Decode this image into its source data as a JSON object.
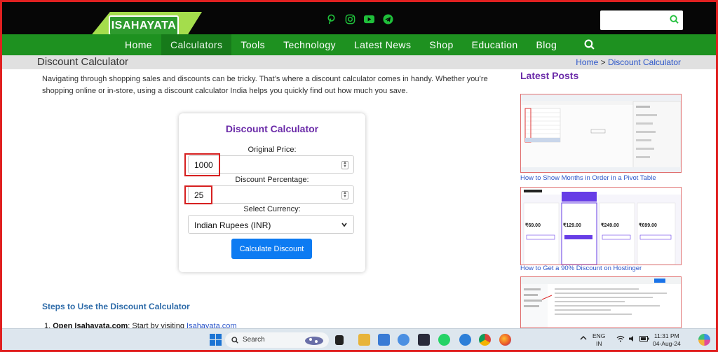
{
  "brand": {
    "logo_text": "ISAHAYATA",
    "accent": "#1e9120",
    "purple": "#6a2aa8"
  },
  "header": {
    "social_icons": [
      "pinterest-icon",
      "instagram-icon",
      "youtube-icon",
      "telegram-icon"
    ],
    "search_placeholder": ""
  },
  "nav": {
    "items": [
      {
        "label": "Home"
      },
      {
        "label": "Calculators"
      },
      {
        "label": "Tools"
      },
      {
        "label": "Technology"
      },
      {
        "label": "Latest News"
      },
      {
        "label": "Shop"
      },
      {
        "label": "Education"
      },
      {
        "label": "Blog"
      }
    ],
    "active_index": 1
  },
  "page": {
    "title": "Discount Calculator",
    "breadcrumb": {
      "home": "Home",
      "separator": ">",
      "current": "Discount Calculator"
    },
    "intro": "Navigating through shopping sales and discounts can be tricky. That’s where a discount calculator comes in handy. Whether you’re shopping online or in-store, using a discount calculator India helps you quickly find out how much you save."
  },
  "calculator": {
    "title": "Discount Calculator",
    "price_label": "Original Price:",
    "price_value": "1000",
    "discount_label": "Discount Percentage:",
    "discount_value": "25",
    "currency_label": "Select Currency:",
    "currency_value": "Indian Rupees (INR)",
    "button_label": "Calculate Discount"
  },
  "steps": {
    "heading": "Steps to Use the Discount Calculator",
    "step1_number": "1.",
    "step1_bold": "Open Isahayata.com",
    "step1_text": ": Start by visiting ",
    "step1_link": "Isahayata.com"
  },
  "sidebar": {
    "title": "Latest Posts",
    "posts": [
      {
        "title": "How to Show Months in Order in a Pivot Table"
      },
      {
        "title": "How to Get a 90% Discount on Hostinger"
      },
      {
        "title": ""
      }
    ],
    "hostinger_prices": [
      "₹69.00",
      "₹129.00",
      "₹249.00",
      "₹699.00"
    ]
  },
  "taskbar": {
    "search_label": "Search",
    "lang_line1": "ENG",
    "lang_line2": "IN",
    "time": "11:31 PM",
    "date": "04-Aug-24"
  }
}
